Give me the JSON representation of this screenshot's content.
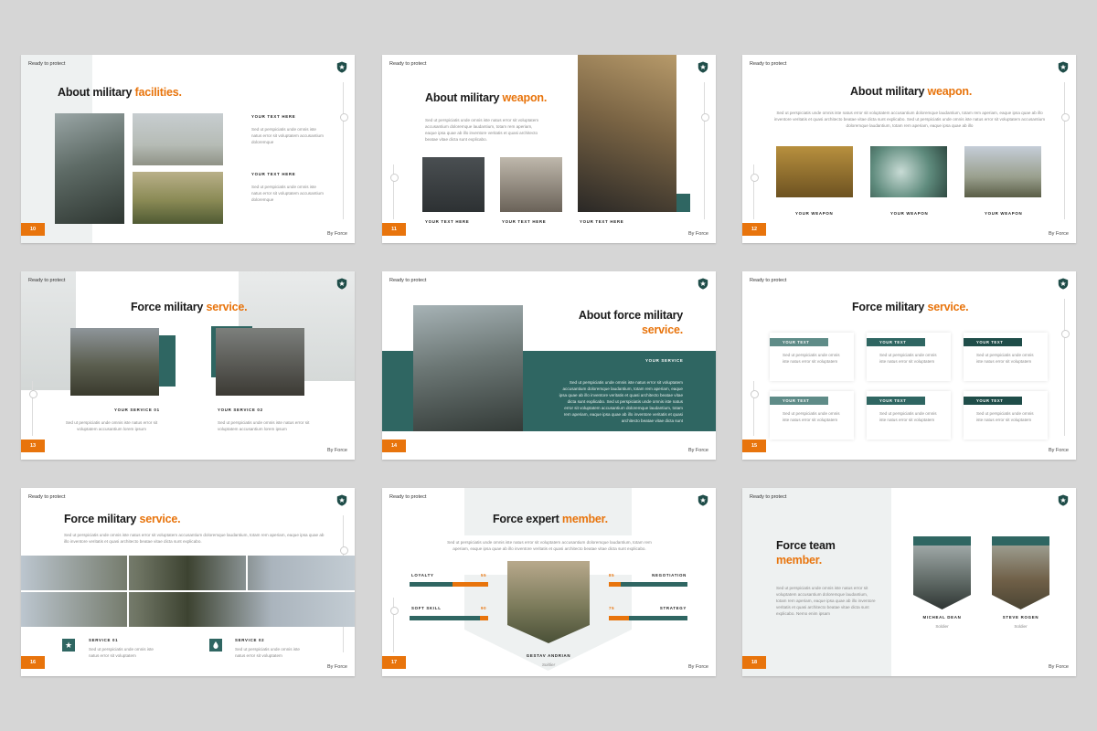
{
  "colors": {
    "accent": "#e8740c",
    "teal": "#2f6662",
    "background": "#d6d6d6"
  },
  "common": {
    "ready": "Ready to protect",
    "by": "By Force",
    "shield_icon": "shield-star-icon"
  },
  "slides": [
    {
      "num": "10",
      "title_a": "About military ",
      "title_b": "facilities.",
      "items": [
        {
          "label": "YOUR TEXT HERE",
          "text": "Sed ut perspiciatis unde omnis iste natus error sit voluptatem accusantium doloremque"
        },
        {
          "label": "YOUR TEXT HERE",
          "text": "Sed ut perspiciatis unde omnis iste natus error sit voluptatem accusantium doloremque"
        }
      ]
    },
    {
      "num": "11",
      "title_a": "About military ",
      "title_b": "weapon.",
      "body": "Sed ut perspiciatis unde omnis iste natus error sit voluptatem accusantium doloremque laudantium, totam rem aperiam, eaque ipsa quae ab illo inventore veritatis et quasi architecto beatae vitae dicta sunt explicabo.",
      "labels": [
        "YOUR TEXT HERE",
        "YOUR TEXT HERE",
        "YOUR TEXT HERE"
      ]
    },
    {
      "num": "12",
      "title_a": "About military ",
      "title_b": "weapon.",
      "body": "Sed ut perspiciatis unde omnis iste natus error sit voluptatem accusantium doloremque laudantium, totam rem aperiam, eaque ipsa quae ab illo inventore veritatis et quasi architecto beatae vitae dicta sunt explicabo. Sed ut perspiciatis unde omnis iste natus error sit voluptatem accusantium doloremque laudantium, totam rem aperiam, eaque ipsa quae ab illo",
      "labels": [
        "YOUR WEAPON",
        "YOUR WEAPON",
        "YOUR WEAPON"
      ]
    },
    {
      "num": "13",
      "title_a": "Force military ",
      "title_b": "service.",
      "items": [
        {
          "label": "YOUR SERVICE 01",
          "text": "Sed ut perspiciatis unde omnis iste natus error sit voluptatem accusantium lorem ipsum"
        },
        {
          "label": "YOUR SERVICE 02",
          "text": "Sed ut perspiciatis unde omnis iste natus error sit voluptatem accusantium lorem ipsum"
        }
      ]
    },
    {
      "num": "14",
      "title_a": "About force military",
      "title_b": "service.",
      "label": "YOUR SERVICE",
      "body": "Sed ut perspiciatis unde omnis iste natus error sit voluptatem accusantium doloremque laudantium, totam rem aperiam, eaque ipsa quae ab illo inventore veritatis et quasi architecto beatae vitae dicta sunt explicabo. Sed ut perspiciatis unde omnis iste natus error sit voluptatem accusantium doloremque laudantium, totam rem aperiam, eaque ipsa quae ab illo inventore veritatis et quasi architecto beatae vitae dicta sunt"
    },
    {
      "num": "15",
      "title_a": "Force military ",
      "title_b": "service.",
      "cards": [
        {
          "label": "YOUR TEXT",
          "text": "Sed ut perspiciatis unde omnis iste natus error sit voluptatem"
        },
        {
          "label": "YOUR TEXT",
          "text": "Sed ut perspiciatis unde omnis iste natus error sit voluptatem"
        },
        {
          "label": "YOUR TEXT",
          "text": "Sed ut perspiciatis unde omnis iste natus error sit voluptatem"
        },
        {
          "label": "YOUR TEXT",
          "text": "Sed ut perspiciatis unde omnis iste natus error sit voluptatem"
        },
        {
          "label": "YOUR TEXT",
          "text": "Sed ut perspiciatis unde omnis iste natus error sit voluptatem"
        },
        {
          "label": "YOUR TEXT",
          "text": "Sed ut perspiciatis unde omnis iste natus error sit voluptatem"
        }
      ]
    },
    {
      "num": "16",
      "title_a": "Force military ",
      "title_b": "service.",
      "body": "Sed ut perspiciatis unde omnis iste natus error sit voluptatem accusantium doloremque laudantium, totam rem aperiam, eaque ipsa quae ab illo inventore veritatis et quasi architecto beatae vitae dicta sunt explicabo.",
      "items": [
        {
          "label": "SERVICE 01",
          "text": "Sed ut perspiciatis unde omnis iste natus error sit voluptatem",
          "icon": "star-icon"
        },
        {
          "label": "SERVICE 02",
          "text": "Sed ut perspiciatis unde omnis iste natus error sit voluptatem",
          "icon": "drop-icon"
        }
      ]
    },
    {
      "num": "17",
      "title_a": "Force expert ",
      "title_b": "member.",
      "body": "Sed ut perspiciatis unde omnis iste natus error sit voluptatem accusantium doloremque laudantium, totam rem aperiam, eaque ipsa quae ab illo inventore veritatis et quasi architecto beatae vitae dicta sunt explicabo.",
      "skills": [
        {
          "name": "LOYALTY",
          "pct": "55",
          "value": 0.55
        },
        {
          "name": "SOFT SKILL",
          "pct": "90",
          "value": 0.9
        },
        {
          "name": "NEGOTIATION",
          "pct": "85",
          "value": 0.85
        },
        {
          "name": "STRATEGY",
          "pct": "75",
          "value": 0.75
        }
      ],
      "member_name": "GESTAV ANDRIAN",
      "member_role": "Soldier"
    },
    {
      "num": "18",
      "title_a": "Force team",
      "title_b": "member.",
      "body": "Sed ut perspiciatis unde omnis iste natus error sit voluptatem accusantium doloremque laudantium, totam rem aperiam, eaque ipsa quae ab illo inventore veritatis et quasi architecto beatae vitae dicta sunt explicabo. Nemo enim ipsam",
      "members": [
        {
          "name": "MICHEAL DEAN",
          "role": "Soldier"
        },
        {
          "name": "STEVE ROGEN",
          "role": "Soldier"
        }
      ]
    }
  ]
}
